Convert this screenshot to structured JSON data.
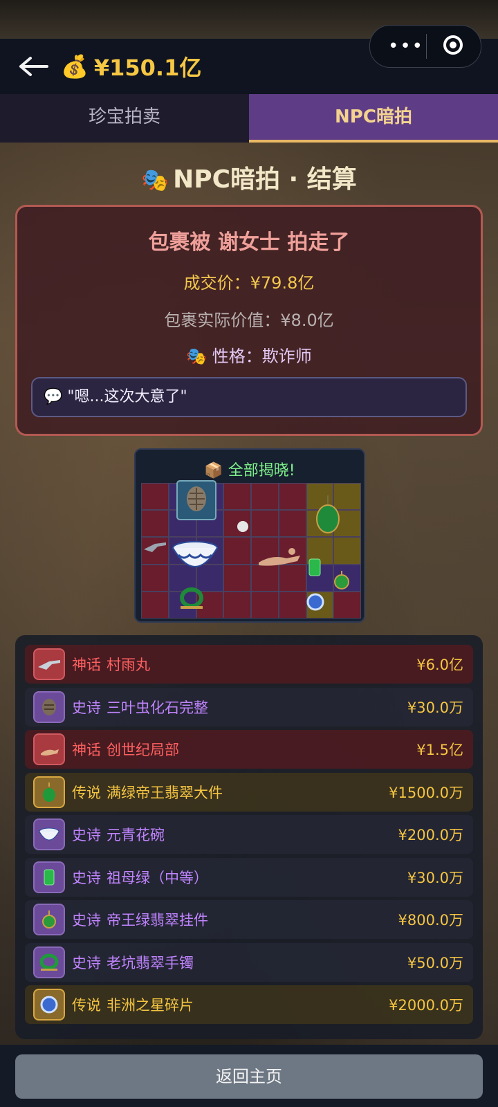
{
  "header": {
    "back_icon": "back-arrow-icon",
    "money_icon": "💰",
    "money": "¥150.1亿"
  },
  "capsule": {
    "more": "•••"
  },
  "tabs": [
    {
      "label": "珍宝拍卖",
      "active": false
    },
    {
      "label": "NPC暗拍",
      "active": true
    }
  ],
  "title": {
    "icon": "🎭",
    "text": "NPC暗拍 · 结算"
  },
  "result": {
    "headline": "包裹被 谢女士 拍走了",
    "deal_price": "成交价：¥79.8亿",
    "real_value": "包裹实际价值：¥8.0亿",
    "trait_icon": "🎭",
    "trait": "性格：欺诈师",
    "quote_icon": "💬",
    "quote": "\"嗯...这次大意了\""
  },
  "reveal": {
    "icon": "📦",
    "title": "全部揭晓!"
  },
  "items": [
    {
      "rarity": "myth",
      "tier": "神话",
      "name": "村雨丸",
      "price": "¥6.0亿",
      "icon": "rifle-icon"
    },
    {
      "rarity": "epic",
      "tier": "史诗",
      "name": "三叶虫化石完整",
      "price": "¥30.0万",
      "icon": "fossil-icon"
    },
    {
      "rarity": "myth",
      "tier": "神话",
      "name": "创世纪局部",
      "price": "¥1.5亿",
      "icon": "painting-icon"
    },
    {
      "rarity": "leg",
      "tier": "传说",
      "name": "满绿帝王翡翠大件",
      "price": "¥1500.0万",
      "icon": "jade-icon"
    },
    {
      "rarity": "epic",
      "tier": "史诗",
      "name": "元青花碗",
      "price": "¥200.0万",
      "icon": "porcelain-bowl-icon"
    },
    {
      "rarity": "epic",
      "tier": "史诗",
      "name": "祖母绿（中等）",
      "price": "¥30.0万",
      "icon": "emerald-icon"
    },
    {
      "rarity": "epic",
      "tier": "史诗",
      "name": "帝王绿翡翠挂件",
      "price": "¥800.0万",
      "icon": "pendant-icon"
    },
    {
      "rarity": "epic",
      "tier": "史诗",
      "name": "老坑翡翠手镯",
      "price": "¥50.0万",
      "icon": "bracelet-icon"
    },
    {
      "rarity": "leg",
      "tier": "传说",
      "name": "非洲之星碎片",
      "price": "¥2000.0万",
      "icon": "diamond-icon"
    }
  ],
  "footer": {
    "home_label": "返回主页"
  }
}
